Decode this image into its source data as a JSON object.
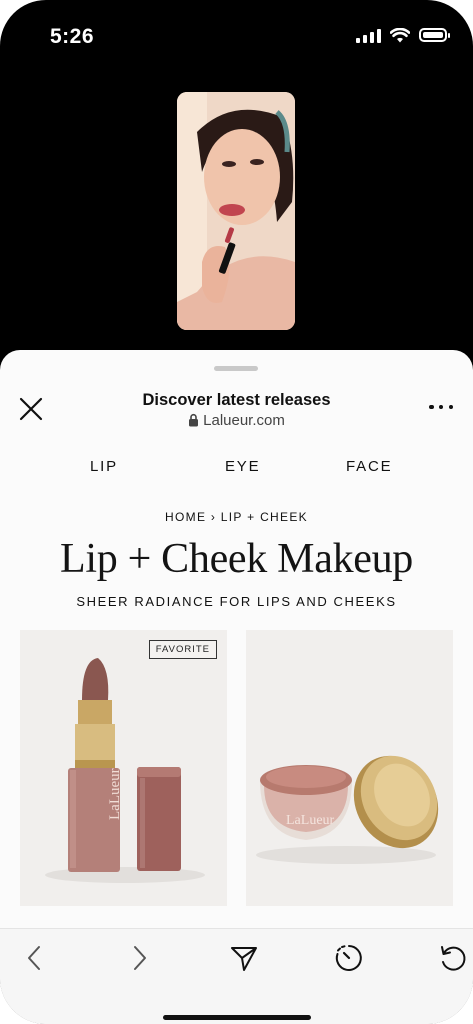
{
  "status_bar": {
    "time": "5:26"
  },
  "sheet": {
    "title": "Discover latest releases",
    "url": "Lalueur.com"
  },
  "categories": [
    "LIP",
    "EYE",
    "FACE"
  ],
  "breadcrumb": "HOME › LIP + CHEEK",
  "page_title": "Lip + Cheek Makeup",
  "subtitle": "SHEER RADIANCE FOR LIPS AND CHEEKS",
  "products": [
    {
      "badge": "FAVORITE",
      "brand": "LaLueur"
    },
    {
      "brand": "LaLueur"
    }
  ],
  "icons": {
    "back": "chevron-left-icon",
    "forward": "chevron-right-icon",
    "share": "send-icon",
    "timer": "timer-icon",
    "reload": "reload-icon"
  },
  "colors": {
    "lipstick": "#8e5d57",
    "gold": "#c9a765",
    "tint": "#b77a6e"
  }
}
